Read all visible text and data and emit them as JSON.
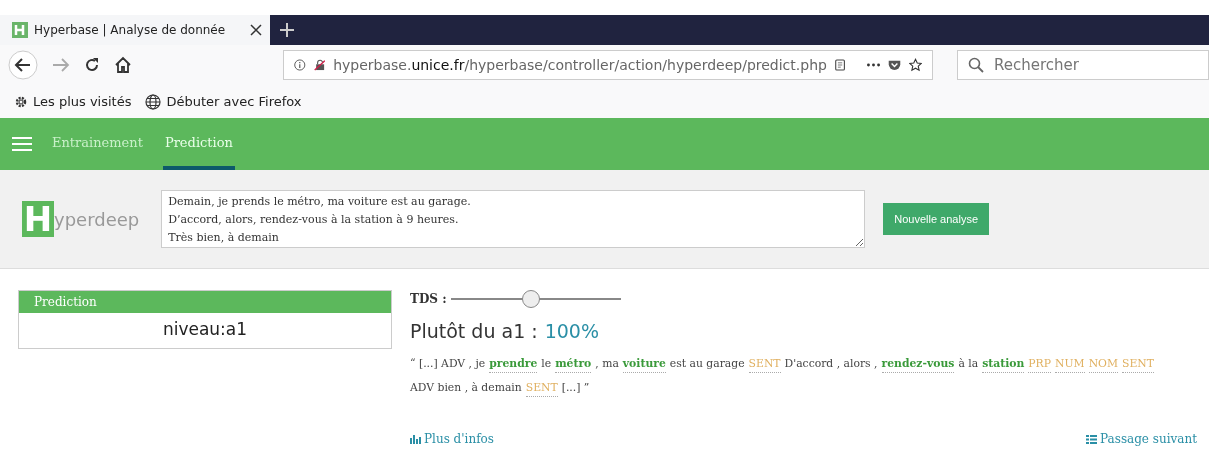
{
  "browser": {
    "tab_title": "Hyperbase | Analyse de donnée",
    "url_host": "hyperbase.",
    "url_domain": "unice.fr",
    "url_path": "/hyperbase/controller/action/hyperdeep/predict.php",
    "search_placeholder": "Rechercher",
    "bookmarks": [
      {
        "kind": "gear",
        "label": "Les plus visités"
      },
      {
        "kind": "globe",
        "label": "Débuter avec Firefox"
      }
    ]
  },
  "nav": {
    "tabs": [
      {
        "label": "Entrainement",
        "selected": false
      },
      {
        "label": "Prediction",
        "selected": true
      }
    ]
  },
  "header": {
    "logo_letter": "H",
    "logo_text": "yperdeep",
    "input": "Demain, je prends le métro, ma voiture est au garage.\nD’accord, alors, rendez-vous à la station à 9 heures.\nTrès bien, à demain",
    "button": "Nouvelle analyse"
  },
  "prediction_card": {
    "title": "Prediction",
    "value": "niveau:a1"
  },
  "result": {
    "tds_label": "TDS :",
    "tds": {
      "level": 0.47
    },
    "headline": "Plutôt du a1 :",
    "score": "100%",
    "passage": [
      {
        "kind": "text",
        "text": "“ [...] ADV , je"
      },
      {
        "kind": "word",
        "text": "prendre"
      },
      {
        "kind": "text",
        "text": "le"
      },
      {
        "kind": "word",
        "text": "métro"
      },
      {
        "kind": "text",
        "text": ", ma"
      },
      {
        "kind": "word",
        "text": "voiture"
      },
      {
        "kind": "text",
        "text": "est au garage"
      },
      {
        "kind": "tag",
        "text": "SENT"
      },
      {
        "kind": "text",
        "text": "D'accord , alors ,"
      },
      {
        "kind": "word",
        "text": "rendez-vous"
      },
      {
        "kind": "text",
        "text": "à la"
      },
      {
        "kind": "word",
        "text": "station"
      },
      {
        "kind": "tag",
        "text": "PRP"
      },
      {
        "kind": "tag",
        "text": "NUM"
      },
      {
        "kind": "tag",
        "text": "NOM"
      },
      {
        "kind": "tag",
        "text": "SENT"
      },
      {
        "kind": "text",
        "text": "ADV bien , à demain"
      },
      {
        "kind": "tag",
        "text": "SENT"
      },
      {
        "kind": "text",
        "text": "[...] ”"
      }
    ],
    "more_link": "Plus d'infos",
    "next_link": "Passage suivant"
  }
}
